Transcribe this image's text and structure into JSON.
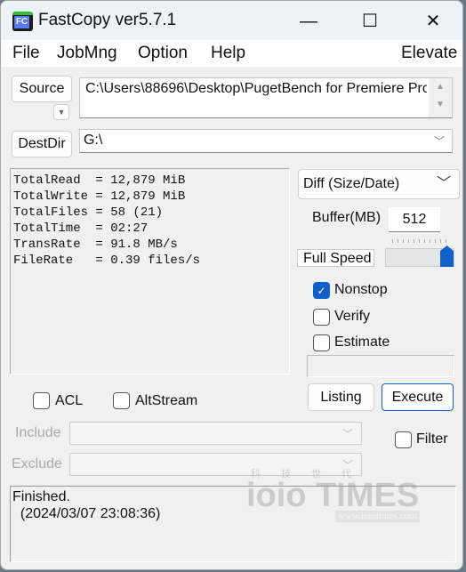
{
  "window": {
    "title": "FastCopy ver5.7.1",
    "minimize": "—",
    "maximize": "☐",
    "close": "✕"
  },
  "menu": {
    "items": [
      "File",
      "JobMng",
      "Option",
      "Help"
    ],
    "elevate": "Elevate"
  },
  "source": {
    "button": "Source",
    "path": "C:\\Users\\88696\\Desktop\\PugetBench for Premiere Pro"
  },
  "dest": {
    "button": "DestDir",
    "path": "G:\\"
  },
  "stats": [
    "TotalRead  = 12,879 MiB",
    "TotalWrite = 12,879 MiB",
    "TotalFiles = 58 (21)",
    "TotalTime  = 02:27",
    "TransRate  = 91.8 MB/s",
    "FileRate   = 0.39 files/s"
  ],
  "mode": {
    "selected": "Diff (Size/Date)"
  },
  "buffer": {
    "label": "Buffer(MB)",
    "value": "512"
  },
  "speed": {
    "label": "Full Speed",
    "level": 1.0
  },
  "options": {
    "nonstop": {
      "label": "Nonstop",
      "checked": true
    },
    "verify": {
      "label": "Verify",
      "checked": false
    },
    "estimate": {
      "label": "Estimate",
      "checked": false
    },
    "acl": {
      "label": "ACL",
      "checked": false
    },
    "altstream": {
      "label": "AltStream",
      "checked": false
    },
    "filter": {
      "label": "Filter",
      "checked": false
    }
  },
  "actions": {
    "listing": "Listing",
    "execute": "Execute"
  },
  "filters": {
    "include_label": "Include",
    "exclude_label": "Exclude",
    "include_value": "",
    "exclude_value": ""
  },
  "status": {
    "line1": "Finished.",
    "line2": "  (2024/03/07 23:08:36)"
  },
  "watermark": {
    "cn": "科 技 世 代",
    "brand": "ioio TIMES",
    "url": "www.ioiotimes.com"
  },
  "colors": {
    "accent": "#1060c8"
  }
}
